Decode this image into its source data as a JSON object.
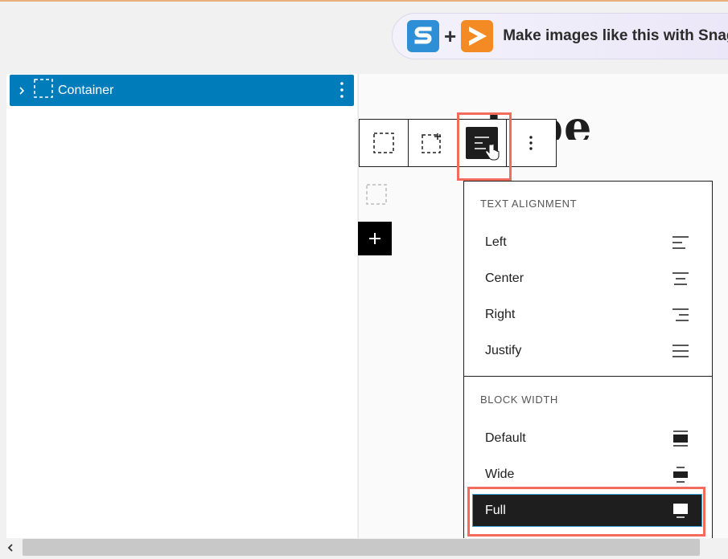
{
  "promo": {
    "text": "Make images like this with Snag",
    "plus": "+",
    "icons": [
      "snagit-logo-icon",
      "play-logo-icon"
    ]
  },
  "list_view": {
    "items": [
      {
        "label": "Container",
        "icon": "container-icon",
        "expanded": false,
        "selected": true
      }
    ]
  },
  "canvas": {
    "background_title": "pagetype"
  },
  "block_toolbar": {
    "buttons": [
      "select-parent",
      "block-type",
      "align",
      "more-options"
    ],
    "active": "align"
  },
  "dropdown": {
    "text_alignment_heading": "TEXT ALIGNMENT",
    "text_alignment": [
      {
        "label": "Left",
        "icon": "align-left-icon"
      },
      {
        "label": "Center",
        "icon": "align-center-icon"
      },
      {
        "label": "Right",
        "icon": "align-right-icon"
      },
      {
        "label": "Justify",
        "icon": "align-justify-icon"
      }
    ],
    "block_width_heading": "BLOCK WIDTH",
    "block_width": [
      {
        "label": "Default",
        "icon": "width-default-icon"
      },
      {
        "label": "Wide",
        "icon": "width-wide-icon"
      },
      {
        "label": "Full",
        "icon": "width-full-icon",
        "selected": true
      }
    ]
  },
  "colors": {
    "accent": "#007cba",
    "highlight": "#f26b5b",
    "selected_bg": "#1e1e1e"
  }
}
